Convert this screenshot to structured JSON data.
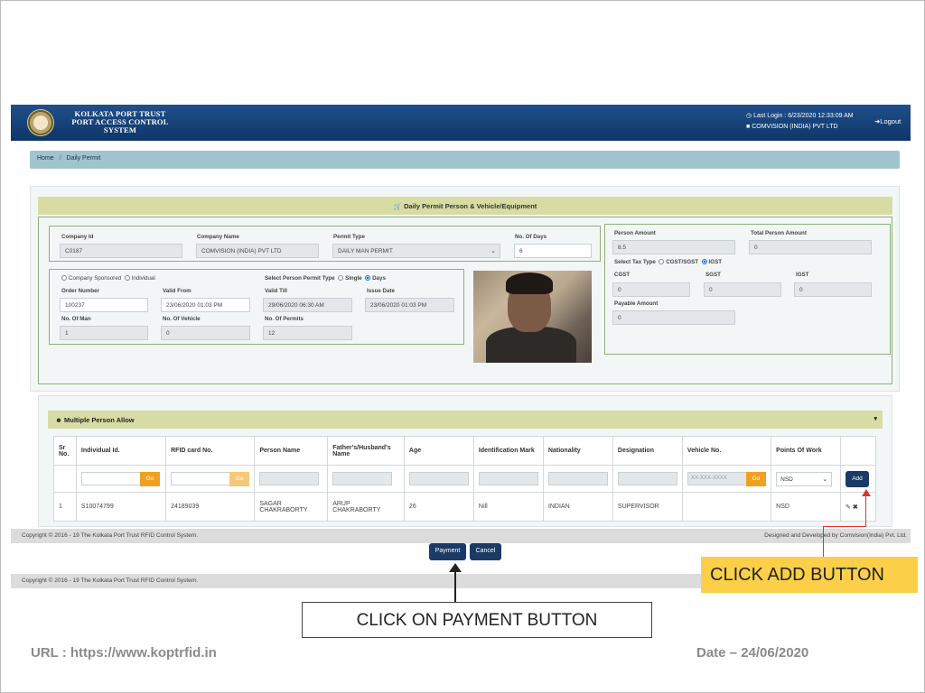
{
  "header": {
    "brand_lines": [
      "KOLKATA PORT TRUST",
      "PORT ACCESS CONTROL",
      "SYSTEM"
    ],
    "last_login": "Last Login : 6/23/2020 12:33:09 AM",
    "company": "COMVISION (INDIA) PVT LTD",
    "logout": "Logout"
  },
  "breadcrumb": {
    "home": "Home",
    "current": "Daily Permit"
  },
  "form": {
    "title": "Daily Permit Person & Vehicle/Equipment",
    "company_id": {
      "label": "Company Id",
      "value": "C0187"
    },
    "company_name": {
      "label": "Company Name",
      "value": "COMVISION (INDIA) PVT LTD"
    },
    "permit_type": {
      "label": "Permit Type",
      "value": "DAILY MAN PERMIT"
    },
    "no_of_days": {
      "label": "No. Of Days",
      "value": "6"
    },
    "sponsor_company": "Company Sponsored",
    "sponsor_individual": "Individual",
    "select_type_label": "Select Person Permit Type",
    "type_single": "Single",
    "type_days": "Days",
    "order_number": {
      "label": "Order Number",
      "value": "100237"
    },
    "valid_from": {
      "label": "Valid From",
      "value": "23/06/2020 01:03 PM"
    },
    "valid_till": {
      "label": "Valid Till",
      "value": "29/06/2020 06:30 AM"
    },
    "issue_date": {
      "label": "Issue Date",
      "value": "23/06/2020 01:03 PM"
    },
    "no_of_man": {
      "label": "No. Of Man",
      "value": "1"
    },
    "no_of_vehicle": {
      "label": "No. Of Vehicle",
      "value": "0"
    },
    "no_of_permits": {
      "label": "No. Of Permits",
      "value": "12"
    }
  },
  "amounts": {
    "person_amount": {
      "label": "Person Amount",
      "value": "8.5"
    },
    "total_person_amount": {
      "label": "Total Person Amount",
      "value": "0"
    },
    "tax_type_label": "Select Tax Type",
    "tax_cgst_sgst": "CGST/SGST",
    "tax_igst": "IGST",
    "cgst": {
      "label": "CGST",
      "value": "0"
    },
    "sgst": {
      "label": "SGST",
      "value": "0"
    },
    "igst": {
      "label": "IGST",
      "value": "0"
    },
    "payable_amount": {
      "label": "Payable Amount",
      "value": "0"
    }
  },
  "multi": {
    "title": "Multiple Person Allow",
    "columns": [
      "Sr No.",
      "Individual Id.",
      "RFID card No.",
      "Person Name",
      "Father's/Husband's Name",
      "Age",
      "Identification Mark",
      "Nationality",
      "Designation",
      "Vehicle No.",
      "Points Of Work",
      ""
    ],
    "go_label": "Go",
    "vehicle_placeholder": "XX-XXX-XXXX",
    "points_select": "NSD",
    "add_label": "Add",
    "row": {
      "sr": "1",
      "individual_id": "S10074799",
      "rfid": "24189039",
      "person_name": "SAGAR CHAKRABORTY",
      "father_name": "ARUP CHAKRABORTY",
      "age": "26",
      "identification": "Nill",
      "nationality": "INDIAN",
      "designation": "SUPERVISOR",
      "vehicle": "",
      "points": "NSD"
    }
  },
  "footer": {
    "copyright": "Copyright © 2016 - 19 The Kolkata Port Trust RFID Control System.",
    "designed": "Designed and Developed by Comvision(India) Pvt. Ltd.",
    "payment_label": "Payment",
    "cancel_label": "Cancel"
  },
  "callouts": {
    "add": "CLICK ADD BUTTON",
    "payment": "CLICK ON PAYMENT BUTTON"
  },
  "slide": {
    "url": "URL : https://www.koptrfid.in",
    "date": "Date – 24/06/2020"
  },
  "colors": {
    "header_blue": "#0e3668",
    "accent_olive": "#d7dca4",
    "go_orange": "#f0a020",
    "button_navy": "#1b3a66",
    "callout_yellow": "#fbcf47",
    "annotation_red": "#e03030"
  }
}
